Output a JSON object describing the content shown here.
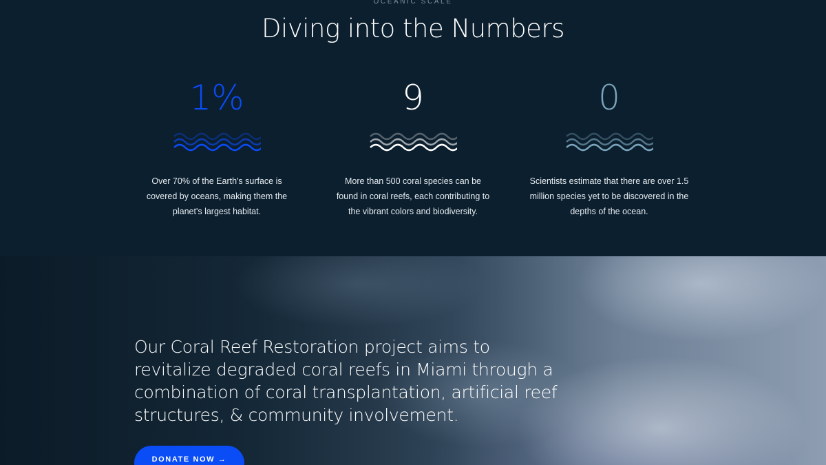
{
  "stats_section": {
    "eyebrow": "OCEANIC SCALE",
    "title": "Diving into the Numbers",
    "stats": [
      {
        "value": "1%",
        "color": "#0a4cf5",
        "wave_icon": "wave-icon",
        "text_lines": [
          "Over 70% of the Earth's surface is",
          "covered by oceans, making them the",
          "planet's largest habitat."
        ]
      },
      {
        "value": "9",
        "color": "#ffffff",
        "wave_icon": "wave-icon",
        "text_lines": [
          "More than 500 coral species can be",
          "found in coral reefs, each contributing to",
          "the vibrant colors and biodiversity."
        ]
      },
      {
        "value": "0",
        "color": "#7aa5bc",
        "wave_icon": "wave-icon",
        "text_lines": [
          "Scientists estimate that there are over 1.5",
          "million species yet to be discovered in the",
          "depths of the ocean."
        ]
      }
    ]
  },
  "hero": {
    "text": "Our Coral Reef Restoration project aims to revitalize degraded coral reefs in Miami through a combination of coral transplantation, artificial reef structures, & community involvement.",
    "button_label": "DONATE NOW →",
    "button_color": "#0a4cf5"
  }
}
